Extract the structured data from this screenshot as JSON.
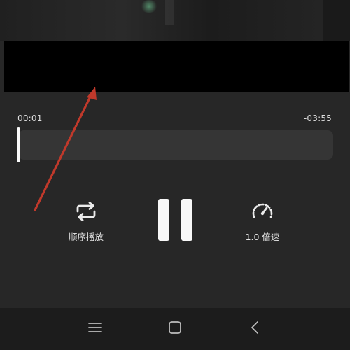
{
  "player": {
    "elapsed_time": "00:01",
    "remaining_time": "-03:55",
    "progress_fraction": 0.004
  },
  "controls": {
    "repeat_label": "顺序播放",
    "speed_label": "1.0 倍速"
  },
  "icons": {
    "repeat": "repeat-icon",
    "pause": "pause-icon",
    "speed": "speedometer-icon",
    "menu": "menu-icon",
    "home": "home-square-icon",
    "back": "back-chevron-icon",
    "arrow": "annotation-arrow-icon"
  },
  "colors": {
    "background": "#272727",
    "track": "#353535",
    "handle": "#fafafa",
    "annotation_arrow": "#c0392b",
    "nav_bar": "#1c1c1c"
  }
}
